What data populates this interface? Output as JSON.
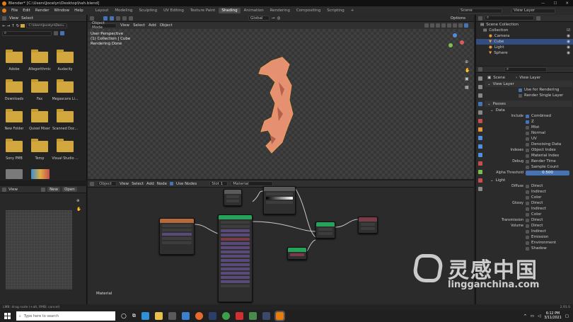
{
  "titlebar": {
    "title": "Blender* [C:\\Users\\Jocelyn\\Desktop\\hah.blend]"
  },
  "menu": {
    "items": [
      "File",
      "Edit",
      "Render",
      "Window",
      "Help"
    ]
  },
  "workspaces": [
    "Layout",
    "Modeling",
    "Sculpting",
    "UV Editing",
    "Texture Paint",
    "Shading",
    "Animation",
    "Rendering",
    "Compositing",
    "Scripting"
  ],
  "top_right": {
    "scene": "Scene",
    "view_layer": "View Layer"
  },
  "file_browser": {
    "view": "View",
    "select": "Select",
    "path": "C:\\Users\\Jocelyn\\Docu...",
    "items": [
      "Adobe",
      "Allegorithmic",
      "Audacity",
      "Downloads",
      "Fax",
      "Megascans Li...",
      "New Folder",
      "Quixel Mixer",
      "Scanned Doc...",
      "Sony PMB",
      "Temp",
      "Visual Studio ..."
    ]
  },
  "image_editor": {
    "view": "View",
    "new": "New",
    "open": "Open"
  },
  "viewport": {
    "mode": "Object Mode",
    "view": "View",
    "select": "Select",
    "add": "Add",
    "object": "Object",
    "transform": "Global",
    "options": "Options",
    "overlay_lines": [
      "User Perspective",
      "(1) Collection | Cube",
      "Rendering Done"
    ]
  },
  "node_editor": {
    "object": "Object",
    "view": "View",
    "select": "Select",
    "add": "Add",
    "node": "Node",
    "use_nodes": "Use Nodes",
    "slot": "Slot 1",
    "material": "Material",
    "label": "Material"
  },
  "outliner": {
    "title": "Scene Collection",
    "items": [
      {
        "label": "Collection",
        "selected": false
      },
      {
        "label": "Camera",
        "selected": false
      },
      {
        "label": "Cube",
        "selected": true
      },
      {
        "label": "Light",
        "selected": false
      },
      {
        "label": "Sphere",
        "selected": false
      }
    ]
  },
  "properties": {
    "scene": "Scene",
    "view_layer": "View Layer",
    "view_layer_section": "View Layer",
    "use_for_rendering": "Use for Rendering",
    "render_single_layer": "Render Single Layer",
    "passes": "Passes",
    "data": "Data",
    "include_label": "Include",
    "include": [
      {
        "label": "Combined",
        "on": true
      },
      {
        "label": "Z",
        "on": true
      },
      {
        "label": "Mist",
        "on": false
      },
      {
        "label": "Normal",
        "on": false
      },
      {
        "label": "UV",
        "on": false
      },
      {
        "label": "Denoising Data",
        "on": false
      }
    ],
    "indexes_label": "Indexes",
    "indexes": [
      {
        "label": "Object Index",
        "on": false
      },
      {
        "label": "Material Index",
        "on": false
      }
    ],
    "debug_label": "Debug",
    "debug": [
      {
        "label": "Render Time",
        "on": false
      },
      {
        "label": "Sample Count",
        "on": false
      }
    ],
    "alpha_threshold_label": "Alpha Threshold",
    "alpha_threshold": "0.500",
    "light": "Light",
    "diffuse_label": "Diffuse",
    "diffuse": [
      "Direct",
      "Indirect",
      "Color"
    ],
    "glossy_label": "Glossy",
    "glossy": [
      "Direct",
      "Indirect",
      "Color"
    ],
    "transmission_label": "Transmission",
    "transmission": [
      "Direct"
    ],
    "volume_label": "Volume",
    "volume": [
      "Direct",
      "Indirect"
    ],
    "other": [
      "Emission",
      "Environment",
      "Shadow"
    ]
  },
  "statusbar": {
    "left": "LMB: drag node (+alt, RMB: cancel)",
    "version": "2.91.0"
  },
  "taskbar": {
    "search": "Type here to search",
    "time": "6:12 PM",
    "date": "3/11/2021"
  },
  "watermark": {
    "cn": "灵感中国",
    "url": "lingganchina.com"
  }
}
